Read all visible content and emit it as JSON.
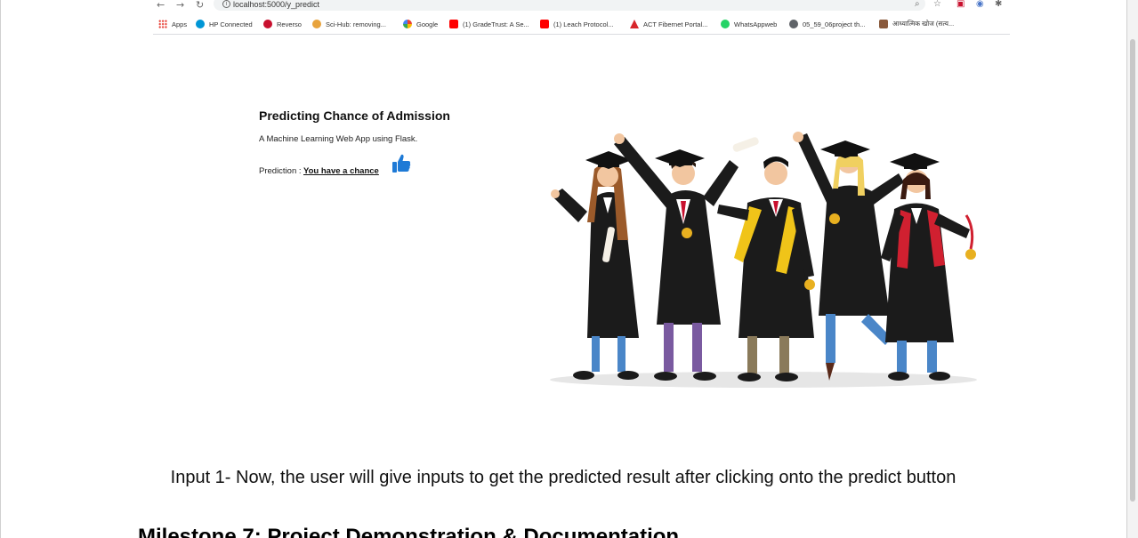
{
  "browser": {
    "url": "localhost:5000/y_predict",
    "bookmarks": [
      {
        "label": "Apps",
        "icon": "apps-grid-icon",
        "color": "#e8453c"
      },
      {
        "label": "HP Connected",
        "icon": "hp-icon",
        "color": "#0096d6"
      },
      {
        "label": "Reverso",
        "icon": "reverso-icon",
        "color": "#c8102e"
      },
      {
        "label": "Sci-Hub: removing...",
        "icon": "scihub-icon",
        "color": "#e8a33c"
      },
      {
        "label": "Google",
        "icon": "google-icon",
        "color": "#4285f4"
      },
      {
        "label": "(1) GradeTrust: A Se...",
        "icon": "youtube-icon",
        "color": "#ff0000"
      },
      {
        "label": "(1) Leach Protocol...",
        "icon": "youtube-icon",
        "color": "#ff0000"
      },
      {
        "label": "ACT Fibernet Portal...",
        "icon": "act-icon",
        "color": "#d7262b"
      },
      {
        "label": "WhatsAppweb",
        "icon": "whatsapp-icon",
        "color": "#25d366"
      },
      {
        "label": "05_59_06project th...",
        "icon": "globe-icon",
        "color": "#5f6368"
      },
      {
        "label": "आध्यात्मिक खोज (सत्य...",
        "icon": "site-icon",
        "color": "#8a5a3c"
      }
    ]
  },
  "app": {
    "title": "Predicting Chance of Admission",
    "subtitle": "A Machine Learning Web App using Flask.",
    "prediction_label": "Prediction : ",
    "prediction_value": "You have a chance"
  },
  "document": {
    "caption": "Input 1- Now, the user will give inputs to get the predicted result after clicking onto the predict button",
    "heading": "Milestone 7: Project Demonstration & Documentation"
  },
  "colors": {
    "thumb": "#1e7ad6",
    "gown": "#1b1b1b",
    "cap": "#111111"
  }
}
